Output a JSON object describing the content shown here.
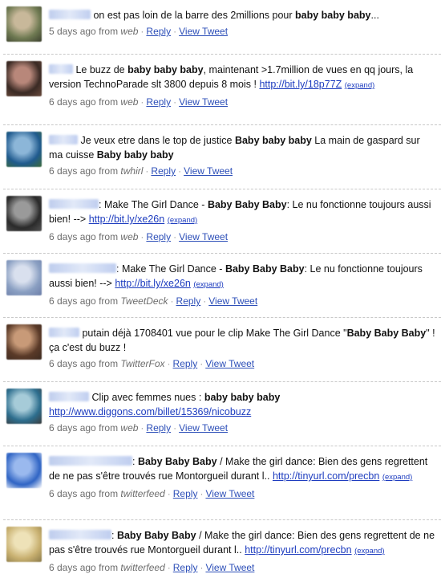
{
  "tweets": [
    {
      "avatar": {
        "c1": "#6f7a52",
        "c2": "#c8b89a",
        "c3": "#3b3f2e"
      },
      "user_w": 52,
      "parts": [
        {
          "t": " on est pas loin de la barre des 2millions pour "
        },
        {
          "b": "baby baby baby"
        },
        {
          "t": "..."
        }
      ],
      "time": "5 days ago",
      "from_label": "from",
      "source": "web",
      "reply": "Reply",
      "view": "View Tweet"
    },
    {
      "avatar": {
        "c1": "#3a2a24",
        "c2": "#b8877a",
        "c3": "#6a4a3c"
      },
      "user_w": 30,
      "parts": [
        {
          "t": " Le buzz de "
        },
        {
          "b": "baby baby baby"
        },
        {
          "t": ", maintenant >1.7million de vues en qq jours, la version TechnoParade slt 3800 depuis 8 mois ! "
        },
        {
          "l": "http://bit.ly/18p77Z"
        },
        {
          "t": " "
        },
        {
          "e": "(expand)"
        }
      ],
      "time": "6 days ago",
      "from_label": "from",
      "source": "web",
      "reply": "Reply",
      "view": "View Tweet"
    },
    {
      "avatar": {
        "c1": "#1f5a8e",
        "c2": "#8cb6d8",
        "c3": "#3d6b3a"
      },
      "user_w": 36,
      "parts": [
        {
          "t": " Je veux etre dans le top de justice "
        },
        {
          "b": "Baby baby baby"
        },
        {
          "t": " La main de gaspard sur ma cuisse "
        },
        {
          "b": "Baby baby baby"
        }
      ],
      "time": "6 days ago",
      "from_label": "from",
      "source": "twhirl",
      "reply": "Reply",
      "view": "View Tweet"
    },
    {
      "avatar": {
        "c1": "#2a2a2a",
        "c2": "#9a9a9a",
        "c3": "#555555"
      },
      "user_w": 62,
      "parts": [
        {
          "t": ": Make The Girl Dance - "
        },
        {
          "b": "Baby Baby Baby"
        },
        {
          "t": ": Le nu fonctionne toujours aussi bien! --> "
        },
        {
          "l": "http://bit.ly/xe26n"
        },
        {
          "t": " "
        },
        {
          "e": "(expand)"
        }
      ],
      "time": "6 days ago",
      "from_label": "from",
      "source": "web",
      "reply": "Reply",
      "view": "View Tweet"
    },
    {
      "avatar": {
        "c1": "#8a9fc2",
        "c2": "#d9e0ee",
        "c3": "#6c7ea8"
      },
      "user_w": 84,
      "parts": [
        {
          "t": ": Make The Girl Dance - "
        },
        {
          "b": "Baby Baby Baby"
        },
        {
          "t": ": Le nu fonctionne toujours aussi bien! --> "
        },
        {
          "l": "http://bit.ly/xe26n"
        },
        {
          "t": " "
        },
        {
          "e": "(expand)"
        }
      ],
      "time": "6 days ago",
      "from_label": "from",
      "source": "TweetDeck",
      "reply": "Reply",
      "view": "View Tweet"
    },
    {
      "avatar": {
        "c1": "#5a3a28",
        "c2": "#c89a78",
        "c3": "#3c2a20"
      },
      "user_w": 38,
      "parts": [
        {
          "t": " putain déjà 1708401 vue pour le clip Make The Girl Dance \""
        },
        {
          "b": "Baby Baby Baby"
        },
        {
          "t": "\" ! ça c'est du buzz !"
        }
      ],
      "time": "6 days ago",
      "from_label": "from",
      "source": "TwitterFox",
      "reply": "Reply",
      "view": "View Tweet"
    },
    {
      "avatar": {
        "c1": "#2d6e8e",
        "c2": "#a6cbd8",
        "c3": "#3c3c3c"
      },
      "user_w": 50,
      "parts": [
        {
          "t": " Clip avec femmes nues : "
        },
        {
          "b": "baby baby baby"
        },
        {
          "t": " "
        },
        {
          "l": "http://www.diggons.com/billet/15369/nicobuzz"
        }
      ],
      "time": "6 days ago",
      "from_label": "from",
      "source": "web",
      "reply": "Reply",
      "view": "View Tweet"
    },
    {
      "avatar": {
        "c1": "#2f64c4",
        "c2": "#9ab9ee",
        "c3": "#ffffff"
      },
      "user_w": 104,
      "parts": [
        {
          "t": ": "
        },
        {
          "b": "Baby Baby Baby"
        },
        {
          "t": " / Make the girl dance: Bien des gens regrettent de ne pas s'être trouvés rue Montorgueil durant l.. "
        },
        {
          "l": "http://tinyurl.com/precbn"
        },
        {
          "t": " "
        },
        {
          "e": "(expand)"
        }
      ],
      "time": "6 days ago",
      "from_label": "from",
      "source": "twitterfeed",
      "reply": "Reply",
      "view": "View Tweet"
    },
    {
      "avatar": {
        "c1": "#c8b070",
        "c2": "#eee2b8",
        "c3": "#8a7a4a"
      },
      "user_w": 78,
      "parts": [
        {
          "t": ": "
        },
        {
          "b": "Baby Baby Baby"
        },
        {
          "t": " / Make the girl dance: Bien des gens regrettent de ne pas s'être trouvés rue Montorgueil durant l.. "
        },
        {
          "l": "http://tinyurl.com/precbn"
        },
        {
          "t": " "
        },
        {
          "e": "(expand)"
        }
      ],
      "time": "6 days ago",
      "from_label": "from",
      "source": "twitterfeed",
      "reply": "Reply",
      "view": "View Tweet"
    }
  ]
}
